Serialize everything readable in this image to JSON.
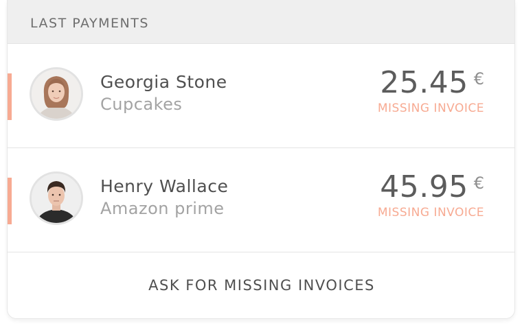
{
  "header": {
    "title": "LAST PAYMENTS"
  },
  "payments": [
    {
      "name": "Georgia Stone",
      "description": "Cupcakes",
      "amount": "25.45",
      "currency": "€",
      "status": "MISSING INVOICE",
      "avatar_icon": "woman-avatar-photo"
    },
    {
      "name": "Henry Wallace",
      "description": "Amazon prime",
      "amount": "45.95",
      "currency": "€",
      "status": "MISSING INVOICE",
      "avatar_icon": "man-avatar-photo"
    }
  ],
  "footer": {
    "action_label": "ASK FOR MISSING INVOICES"
  },
  "colors": {
    "accent": "#f7aa92",
    "header_background": "#efefef",
    "text_primary": "#4f4f4f",
    "text_secondary": "#a3a3a3"
  }
}
